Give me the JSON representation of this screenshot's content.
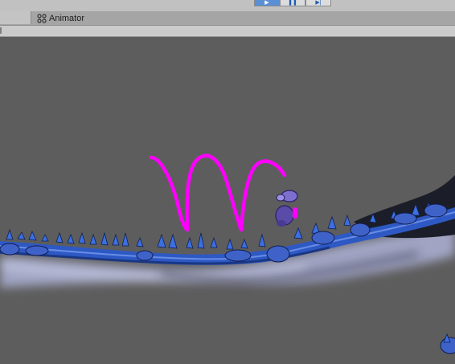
{
  "window": {
    "tab_animator_label": "Animator"
  },
  "play_controls": [
    {
      "name": "play-button",
      "glyph": "▶",
      "active": true
    },
    {
      "name": "pause-button",
      "glyph": "❚❚",
      "active": false
    },
    {
      "name": "step-button",
      "glyph": "▶|",
      "active": false
    }
  ],
  "icons": {
    "animator_tab": "animator-icon"
  },
  "colors": {
    "viewport_background": "#5d5d5d",
    "trajectory": "#ff00ff",
    "terrain_blue": "#2e59c4",
    "terrain_mist": "#a8adcf"
  }
}
